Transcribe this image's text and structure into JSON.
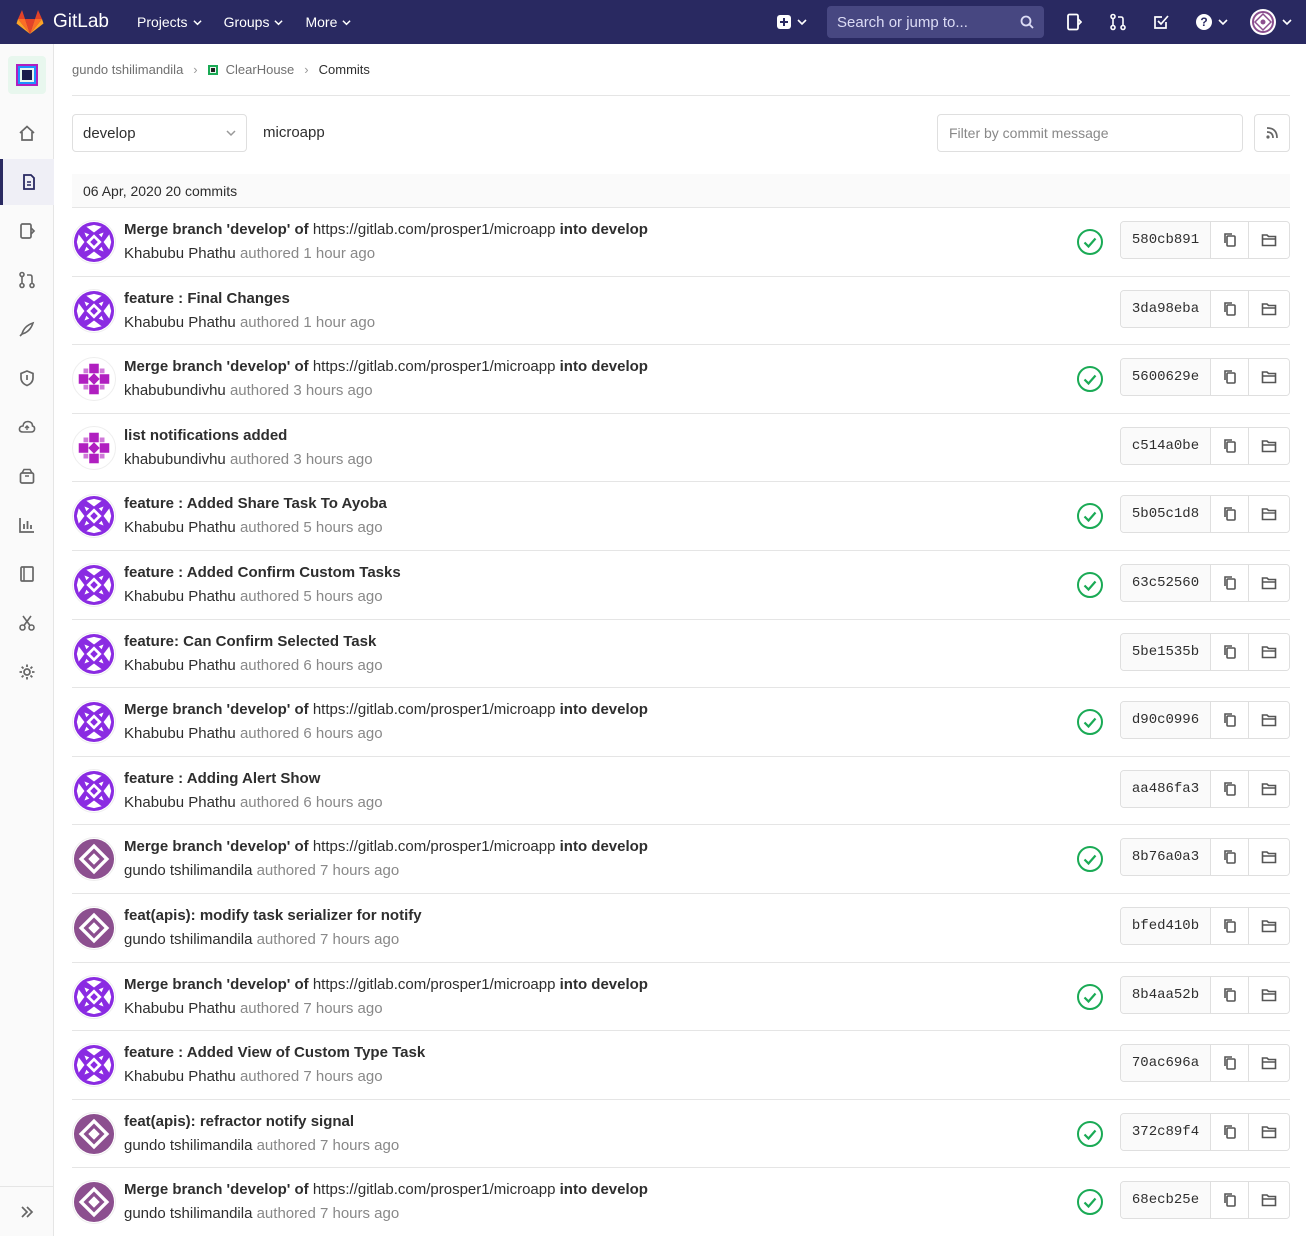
{
  "navbar": {
    "brand": "GitLab",
    "links": [
      "Projects",
      "Groups",
      "More"
    ],
    "search_placeholder": "Search or jump to..."
  },
  "breadcrumb": {
    "owner": "gundo tshilimandila",
    "project": "ClearHouse",
    "current": "Commits"
  },
  "toolbar": {
    "branch": "develop",
    "path": "microapp",
    "filter_placeholder": "Filter by commit message"
  },
  "day_header": "06 Apr, 2020 20 commits",
  "commits": [
    {
      "title": "Merge branch 'develop' of ",
      "url": "https://gitlab.com/prosper1/microapp",
      "title_suffix": " into develop",
      "author": "Khabubu Phathu",
      "time": "authored 1 hour ago",
      "sha": "580cb891",
      "pipeline": true,
      "avatar": "purple"
    },
    {
      "title": "feature : Final Changes",
      "url": "",
      "title_suffix": "",
      "author": "Khabubu Phathu",
      "time": "authored 1 hour ago",
      "sha": "3da98eba",
      "pipeline": false,
      "avatar": "purple"
    },
    {
      "title": "Merge branch 'develop' of ",
      "url": "https://gitlab.com/prosper1/microapp",
      "title_suffix": " into develop",
      "author": "khabubundivhu",
      "time": "authored 3 hours ago",
      "sha": "5600629e",
      "pipeline": true,
      "avatar": "magenta"
    },
    {
      "title": "list notifications added",
      "url": "",
      "title_suffix": "",
      "author": "khabubundivhu",
      "time": "authored 3 hours ago",
      "sha": "c514a0be",
      "pipeline": false,
      "avatar": "magenta"
    },
    {
      "title": "feature : Added Share Task To Ayoba",
      "url": "",
      "title_suffix": "",
      "author": "Khabubu Phathu",
      "time": "authored 5 hours ago",
      "sha": "5b05c1d8",
      "pipeline": true,
      "avatar": "purple"
    },
    {
      "title": "feature : Added Confirm Custom Tasks",
      "url": "",
      "title_suffix": "",
      "author": "Khabubu Phathu",
      "time": "authored 5 hours ago",
      "sha": "63c52560",
      "pipeline": true,
      "avatar": "purple"
    },
    {
      "title": "feature: Can Confirm Selected Task",
      "url": "",
      "title_suffix": "",
      "author": "Khabubu Phathu",
      "time": "authored 6 hours ago",
      "sha": "5be1535b",
      "pipeline": false,
      "avatar": "purple"
    },
    {
      "title": "Merge branch 'develop' of ",
      "url": "https://gitlab.com/prosper1/microapp",
      "title_suffix": " into develop",
      "author": "Khabubu Phathu",
      "time": "authored 6 hours ago",
      "sha": "d90c0996",
      "pipeline": true,
      "avatar": "purple"
    },
    {
      "title": "feature : Adding Alert Show",
      "url": "",
      "title_suffix": "",
      "author": "Khabubu Phathu",
      "time": "authored 6 hours ago",
      "sha": "aa486fa3",
      "pipeline": false,
      "avatar": "purple"
    },
    {
      "title": "Merge branch 'develop' of ",
      "url": "https://gitlab.com/prosper1/microapp",
      "title_suffix": " into develop",
      "author": "gundo tshilimandila",
      "time": "authored 7 hours ago",
      "sha": "8b76a0a3",
      "pipeline": true,
      "avatar": "mauve"
    },
    {
      "title": "feat(apis): modify task serializer for notify",
      "url": "",
      "title_suffix": "",
      "author": "gundo tshilimandila",
      "time": "authored 7 hours ago",
      "sha": "bfed410b",
      "pipeline": false,
      "avatar": "mauve"
    },
    {
      "title": "Merge branch 'develop' of ",
      "url": "https://gitlab.com/prosper1/microapp",
      "title_suffix": " into develop",
      "author": "Khabubu Phathu",
      "time": "authored 7 hours ago",
      "sha": "8b4aa52b",
      "pipeline": true,
      "avatar": "purple"
    },
    {
      "title": "feature : Added View of Custom Type Task",
      "url": "",
      "title_suffix": "",
      "author": "Khabubu Phathu",
      "time": "authored 7 hours ago",
      "sha": "70ac696a",
      "pipeline": false,
      "avatar": "purple"
    },
    {
      "title": "feat(apis): refractor notify signal",
      "url": "",
      "title_suffix": "",
      "author": "gundo tshilimandila",
      "time": "authored 7 hours ago",
      "sha": "372c89f4",
      "pipeline": true,
      "avatar": "mauve"
    },
    {
      "title": "Merge branch 'develop' of ",
      "url": "https://gitlab.com/prosper1/microapp",
      "title_suffix": " into develop",
      "author": "gundo tshilimandila",
      "time": "authored 7 hours ago",
      "sha": "68ecb25e",
      "pipeline": true,
      "avatar": "mauve"
    }
  ],
  "colors": {
    "navbar": "#292961",
    "success": "#1aaa55",
    "avatar_purple": "#8a2be2",
    "avatar_magenta": "#b01fc0",
    "avatar_mauve": "#8c4f8f"
  },
  "icons": {
    "sidebar": [
      "home-icon",
      "repository-icon",
      "issues-icon",
      "merge-request-icon",
      "rocket-icon",
      "shield-icon",
      "cloud-icon",
      "package-icon",
      "chart-icon",
      "book-icon",
      "scissors-icon",
      "settings-icon"
    ]
  }
}
